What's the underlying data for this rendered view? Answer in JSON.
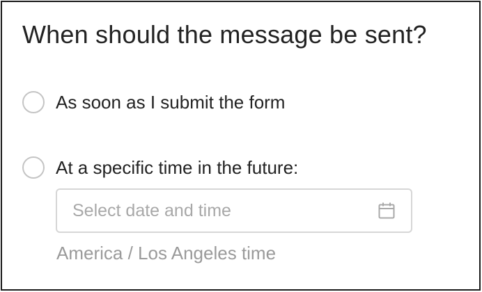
{
  "form": {
    "title": "When should the message be sent?",
    "options": [
      {
        "label": "As soon as I submit the form",
        "selected": false
      },
      {
        "label": "At a specific time in the future:",
        "selected": false
      }
    ],
    "datetime": {
      "placeholder": "Select date and time",
      "value": "",
      "icon": "calendar-icon"
    },
    "timezone_label": "America / Los Angeles time"
  },
  "colors": {
    "border": "#1a1a1a",
    "text": "#222222",
    "muted": "#9a9a9a",
    "radio_border": "#c4c4c4",
    "input_border": "#d6d6d6"
  }
}
